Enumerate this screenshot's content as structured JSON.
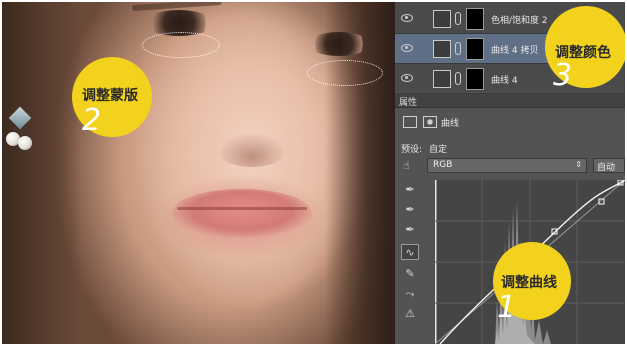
{
  "badges": {
    "mask": {
      "text": "调整蒙版",
      "number": "2"
    },
    "color": {
      "text": "调整颜色",
      "number": "3"
    },
    "curve": {
      "text": "调整曲线",
      "number": "1"
    }
  },
  "layers": [
    {
      "name": "色相/饱和度 2",
      "selected": false
    },
    {
      "name": "曲线 4 拷贝",
      "selected": true
    },
    {
      "name": "曲线 4",
      "selected": false
    }
  ],
  "properties": {
    "title": "属性",
    "type_label": "曲线",
    "preset_label": "预设:",
    "preset_value": "自定",
    "channel_value": "RGB",
    "auto_label": "自动"
  },
  "icons": {
    "tools": [
      "hand-adjust-icon",
      "eyedropper-black-icon",
      "eyedropper-gray-icon",
      "eyedropper-white-icon",
      "curve-tool-icon",
      "pencil-icon",
      "smooth-icon",
      "clipping-icon"
    ]
  },
  "colors": {
    "badge": "#f2d21c",
    "panel": "#535353",
    "selected_layer": "#5f6f86"
  }
}
